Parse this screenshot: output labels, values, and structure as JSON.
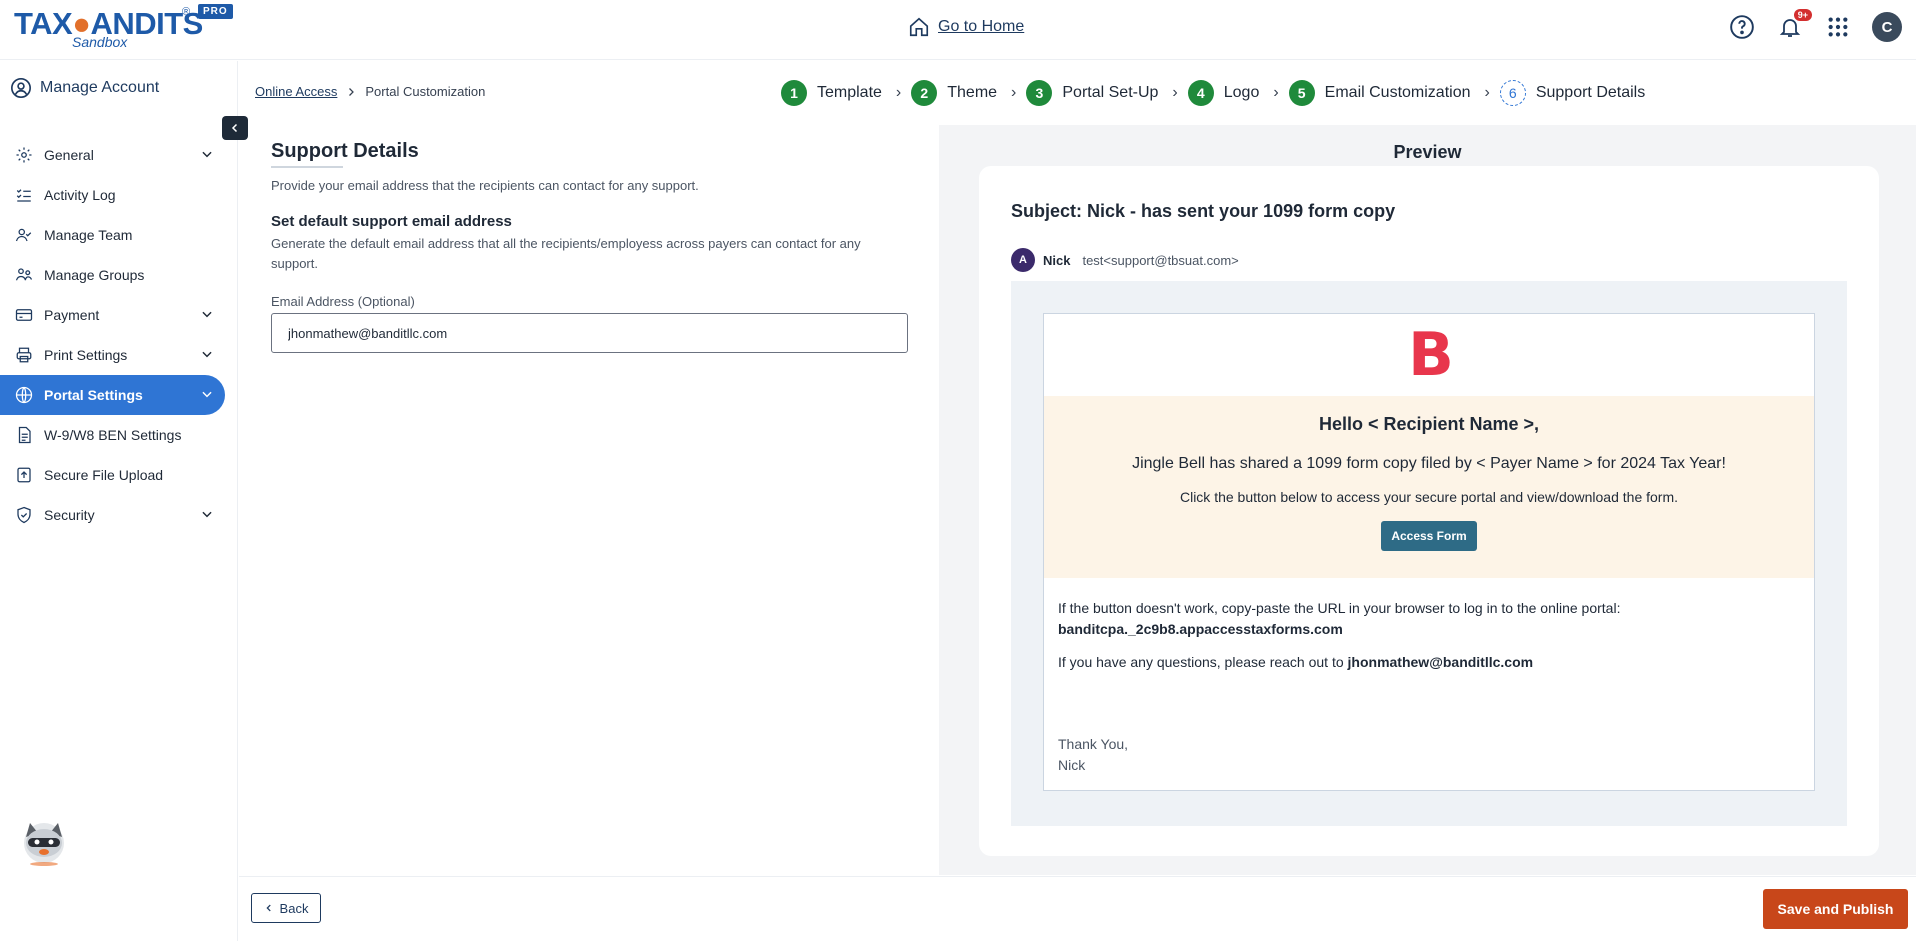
{
  "header": {
    "logo_text_a": "TAX",
    "logo_text_owl": "🦉",
    "logo_text_b": "ANDITS",
    "logo_reg": "®",
    "logo_pro": "PRO",
    "logo_sub": "Sandbox",
    "go_home": "Go to Home",
    "notification_count": "9+",
    "avatar_initial": "C"
  },
  "sidebar": {
    "title": "Manage Account",
    "items": [
      {
        "label": "General",
        "icon": "gear-icon",
        "has_chevron": true
      },
      {
        "label": "Activity Log",
        "icon": "checklist-icon",
        "has_chevron": false
      },
      {
        "label": "Manage Team",
        "icon": "team-icon",
        "has_chevron": false
      },
      {
        "label": "Manage Groups",
        "icon": "groups-icon",
        "has_chevron": false
      },
      {
        "label": "Payment",
        "icon": "payment-icon",
        "has_chevron": true
      },
      {
        "label": "Print Settings",
        "icon": "printer-icon",
        "has_chevron": true
      },
      {
        "label": "Portal Settings",
        "icon": "globe-icon",
        "has_chevron": true,
        "active": true
      },
      {
        "label": "W-9/W8 BEN Settings",
        "icon": "document-icon",
        "has_chevron": false
      },
      {
        "label": "Secure File Upload",
        "icon": "upload-icon",
        "has_chevron": false
      },
      {
        "label": "Security",
        "icon": "shield-icon",
        "has_chevron": true
      }
    ]
  },
  "breadcrumb": {
    "parent": "Online Access",
    "current": "Portal Customization"
  },
  "steps": [
    {
      "num": "1",
      "label": "Template"
    },
    {
      "num": "2",
      "label": "Theme"
    },
    {
      "num": "3",
      "label": "Portal Set-Up"
    },
    {
      "num": "4",
      "label": "Logo"
    },
    {
      "num": "5",
      "label": "Email Customization"
    },
    {
      "num": "6",
      "label": "Support Details"
    }
  ],
  "form": {
    "title": "Support Details",
    "description": "Provide your email address that the recipients can contact for any support.",
    "section_title": "Set default support email address",
    "section_desc": "Generate the default email address that all the recipients/employess across payers can contact for any support.",
    "email_label": "Email Address (Optional)",
    "email_value": "jhonmathew@banditllc.com"
  },
  "preview": {
    "title": "Preview",
    "subject": "Subject: Nick - has sent your 1099 form copy",
    "sender_initial": "A",
    "sender_name": "Nick",
    "sender_address": "test<support@tbsuat.com>",
    "logo_letter": "B",
    "hello": "Hello < Recipient Name >,",
    "shared": "Jingle Bell has shared a 1099 form copy filed by < Payer Name > for 2024 Tax Year!",
    "click": "Click the button below to access your secure portal and view/download the form.",
    "access_button": "Access Form",
    "fallback_text": "If the button doesn't work, copy-paste the URL in your browser to log in to the online portal:",
    "url": "banditcpa._2c9b8.appaccesstaxforms.com",
    "questions_text": "If you have any questions, please reach out to",
    "questions_email": "jhonmathew@banditllc.com",
    "thanks": "Thank You,",
    "signature": "Nick"
  },
  "footer": {
    "back": "Back",
    "publish": "Save and Publish"
  },
  "colors": {
    "primary": "#2f75d4",
    "step_done": "#1f8a3b",
    "publish": "#c8471a",
    "access_button": "#2e6b86",
    "hero_bg": "#fdf4e7",
    "brand_logo": "#e8364c"
  }
}
